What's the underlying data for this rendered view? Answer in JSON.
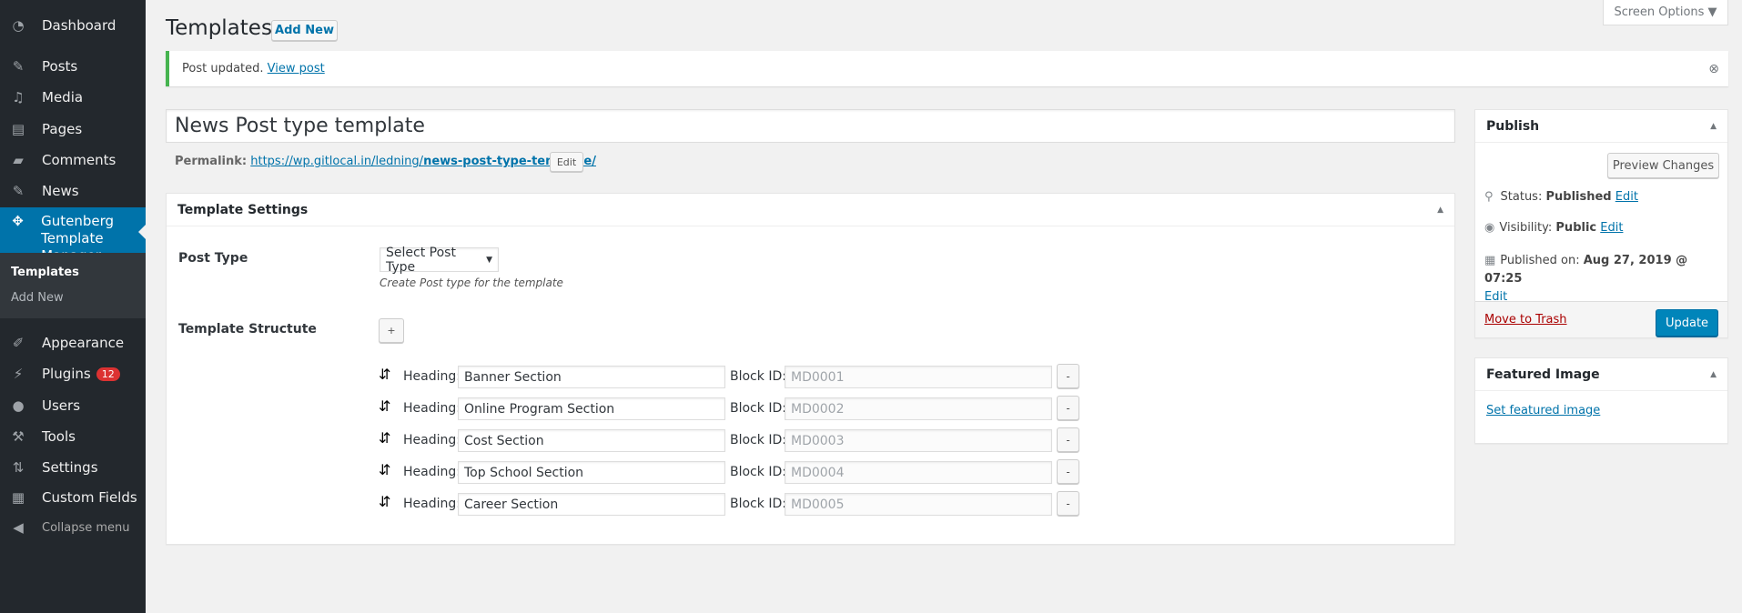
{
  "sidebar": {
    "items": [
      {
        "label": "Dashboard",
        "icon": "dashboard-icon"
      },
      {
        "label": "Posts",
        "icon": "pin-icon"
      },
      {
        "label": "Media",
        "icon": "media-icon"
      },
      {
        "label": "Pages",
        "icon": "pages-icon"
      },
      {
        "label": "Comments",
        "icon": "comment-icon"
      },
      {
        "label": "News",
        "icon": "pin-icon"
      },
      {
        "label": "Gutenberg Template Manager",
        "icon": "groups-icon"
      },
      {
        "label": "Appearance",
        "icon": "brush-icon"
      },
      {
        "label": "Plugins",
        "icon": "plug-icon",
        "badge": "12"
      },
      {
        "label": "Users",
        "icon": "user-icon"
      },
      {
        "label": "Tools",
        "icon": "wrench-icon"
      },
      {
        "label": "Settings",
        "icon": "settings-icon"
      },
      {
        "label": "Custom Fields",
        "icon": "table-icon"
      },
      {
        "label": "Collapse menu",
        "icon": "collapse-icon"
      }
    ],
    "submenu": [
      {
        "label": "Templates"
      },
      {
        "label": "Add New"
      }
    ]
  },
  "header": {
    "title": "Templates",
    "add_new": "Add New",
    "screen_options": "Screen Options ▼"
  },
  "notice": {
    "text": "Post updated.",
    "link": "View post",
    "accent": "#46b450"
  },
  "post": {
    "title": "News Post type template",
    "permalink_label": "Permalink:",
    "permalink_base": "https://wp.gitlocal.in/ledning/",
    "permalink_slug": "news-post-type-template/",
    "edit": "Edit"
  },
  "settings": {
    "title": "Template Settings",
    "post_type_label": "Post Type",
    "post_type_value": "Select Post Type",
    "post_type_help": "Create Post type for the template",
    "structure_label": "Template Structute",
    "add_label": "+",
    "heading_label": "Heading:",
    "block_label": "Block ID:",
    "remove_label": "-",
    "rows": [
      {
        "heading": "Banner Section",
        "block_id": "MD0001"
      },
      {
        "heading": "Online Program Section",
        "block_id": "MD0002"
      },
      {
        "heading": "Cost Section",
        "block_id": "MD0003"
      },
      {
        "heading": "Top School Section",
        "block_id": "MD0004"
      },
      {
        "heading": "Career Section",
        "block_id": "MD0005"
      }
    ]
  },
  "publish": {
    "title": "Publish",
    "preview": "Preview Changes",
    "status_label": "Status:",
    "status": "Published",
    "visibility_label": "Visibility:",
    "visibility": "Public",
    "published_label": "Published on:",
    "published": "Aug 27, 2019 @ 07:25",
    "edit": "Edit",
    "trash": "Move to Trash",
    "update": "Update",
    "update_color": "#0085ba"
  },
  "featured": {
    "title": "Featured Image",
    "link": "Set featured image"
  }
}
